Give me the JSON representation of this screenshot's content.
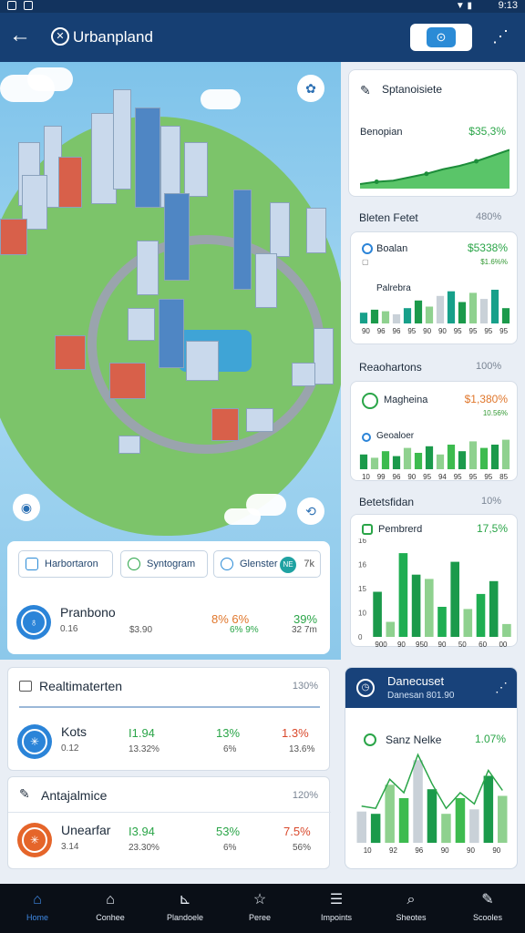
{
  "status_bar": {
    "time": "9:13"
  },
  "app_bar": {
    "title": "Urbanpland"
  },
  "map_chips": [
    {
      "label": "Harbortaron"
    },
    {
      "label": "Syntogram"
    },
    {
      "label": "Glenster",
      "badge": "NE",
      "suffix": "7k"
    }
  ],
  "map_summary": {
    "label": "Pranbono",
    "sub": "0.16",
    "col1": "8% 6%",
    "col1_sub": "$3.90",
    "col2": "6%",
    "col2_sub": "6% 9%",
    "col3": "39%",
    "col3_sub": "32 7m"
  },
  "list_left_1": {
    "title": "Realtimaterten",
    "value": "130%",
    "row": {
      "label": "Kots",
      "sub": "0.12",
      "c1": "I1.94",
      "c1_sub": "13.32%",
      "c2": "13%",
      "c2_sub": "6%",
      "c3": "1.3%",
      "c3_sub": "13.6%"
    }
  },
  "list_left_2": {
    "title": "Antajalmice",
    "value": "120%",
    "row": {
      "label": "Unearfar",
      "sub": "3.14",
      "c1": "I3.94",
      "c1_sub": "23.30%",
      "c2": "53%",
      "c2_sub": "6%",
      "c3": "7.5%",
      "c3_sub": "56%"
    }
  },
  "right_cards": {
    "overview": {
      "title": "Sptanoisiete",
      "metric": "Benopian",
      "value": "$35,3%"
    },
    "section1": {
      "title": "Bleten Fetet",
      "value": "480%",
      "m1": "Boalan",
      "m1_value": "$5338%",
      "m1_sub": "$1.6%%",
      "m2": "Palrebra"
    },
    "section2": {
      "title": "Reaohartons",
      "value": "100%",
      "m1": "Magheina",
      "m1_value": "$1,380%",
      "m1_sub": "10.56%",
      "m2": "Geoaloer"
    },
    "section3": {
      "title": "Betetsfidan",
      "value": "10%",
      "m1": "Pembrerd",
      "m1_value": "17,5%"
    }
  },
  "promo": {
    "title": "Danecuset",
    "subtitle": "Danesan 801.90",
    "metric": "Sanz Nelke",
    "value": "1.07%"
  },
  "bottom_nav": [
    {
      "label": "Home",
      "icon": "home-icon"
    },
    {
      "label": "Conhee",
      "icon": "house-icon"
    },
    {
      "label": "Plandoele",
      "icon": "chart-icon"
    },
    {
      "label": "Peree",
      "icon": "star-icon"
    },
    {
      "label": "Impoints",
      "icon": "document-icon"
    },
    {
      "label": "Sheotes",
      "icon": "search-icon"
    },
    {
      "label": "Scooles",
      "icon": "edit-icon"
    }
  ],
  "chart_data": [
    {
      "type": "area",
      "series": [
        {
          "values": [
            8,
            12,
            14,
            20,
            26,
            34,
            40,
            48,
            58,
            68
          ]
        }
      ],
      "ylim": [
        0,
        80
      ]
    },
    {
      "type": "bar",
      "x_labels": [
        "90",
        "96",
        "96",
        "95",
        "90",
        "90",
        "95",
        "95",
        "95",
        "95"
      ],
      "series": [
        {
          "values": [
            14,
            18,
            16,
            12,
            20,
            30,
            22,
            36,
            42,
            28,
            40,
            32,
            44,
            20
          ]
        }
      ],
      "ylim": [
        0,
        50
      ]
    },
    {
      "type": "bar",
      "x_labels": [
        "10",
        "99",
        "96",
        "90",
        "95",
        "94",
        "95",
        "95",
        "95",
        "85"
      ],
      "series": [
        {
          "values": [
            18,
            14,
            22,
            16,
            26,
            20,
            28,
            18,
            30,
            22,
            34,
            26,
            30,
            36
          ]
        }
      ],
      "ylim": [
        0,
        40
      ]
    },
    {
      "type": "bar",
      "y_ticks": [
        "0",
        "10",
        "15",
        "16",
        "16"
      ],
      "x_labels": [
        "900",
        "90",
        "950",
        "90",
        "50",
        "60",
        "00"
      ],
      "series": [
        {
          "values": [
            42,
            14,
            78,
            58,
            54,
            28,
            70,
            26,
            40,
            52,
            12
          ]
        }
      ],
      "ylim": [
        0,
        90
      ]
    },
    {
      "type": "bar",
      "x_labels": [
        "10",
        "92",
        "96",
        "90",
        "90",
        "90"
      ],
      "series": [
        {
          "values": [
            28,
            26,
            52,
            40,
            74,
            48,
            26,
            40,
            30,
            60,
            42
          ]
        }
      ],
      "ylim": [
        0,
        80
      ]
    }
  ]
}
